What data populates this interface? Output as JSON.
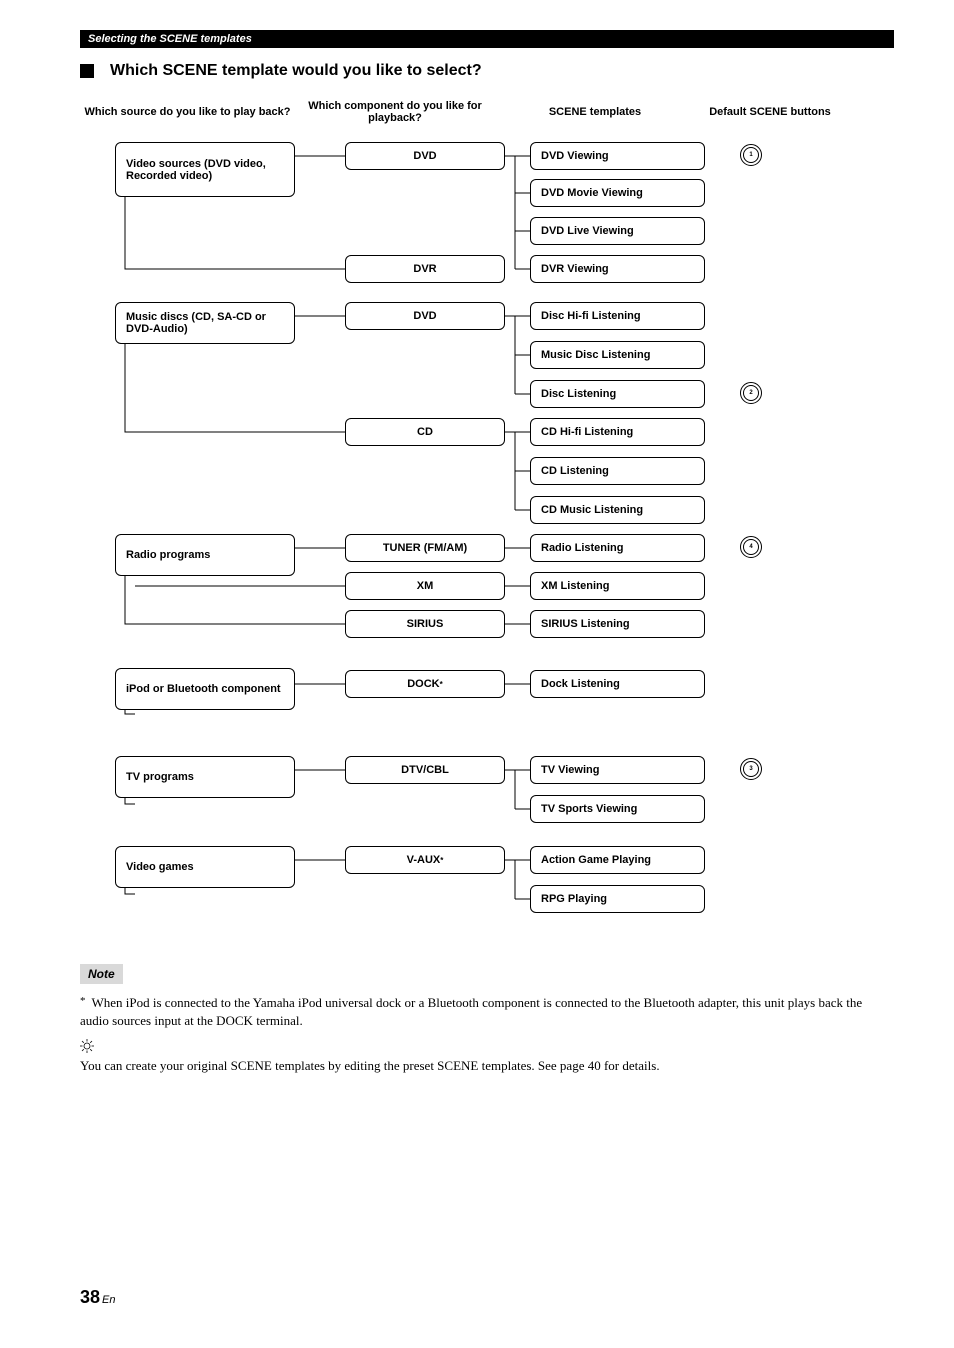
{
  "header_bar": "Selecting the SCENE templates",
  "section_title": "Which SCENE template would you like to select?",
  "columns": {
    "c1": "Which source do you like to play back?",
    "c2": "Which component do you like for playback?",
    "c3": "SCENE templates",
    "c4": "Default SCENE buttons"
  },
  "sources": {
    "video": "Video sources (DVD video, Recorded video)",
    "music": "Music discs (CD, SA-CD or DVD-Audio)",
    "radio": "Radio programs",
    "ipod": "iPod or Bluetooth component",
    "tv": "TV programs",
    "games": "Video games"
  },
  "components": {
    "dvd1": "DVD",
    "dvr": "DVR",
    "dvd2": "DVD",
    "cd": "CD",
    "tuner": "TUNER (FM/AM)",
    "xm": "XM",
    "sirius": "SIRIUS",
    "dock": "DOCK",
    "dtv": "DTV/CBL",
    "vaux": "V-AUX"
  },
  "templates": {
    "dvd_view": "DVD Viewing",
    "dvd_movie": "DVD Movie Viewing",
    "dvd_live": "DVD Live Viewing",
    "dvr_view": "DVR Viewing",
    "disc_hifi": "Disc Hi-fi Listening",
    "music_disc": "Music Disc Listening",
    "disc_listen": "Disc Listening",
    "cd_hifi": "CD Hi-fi Listening",
    "cd_listen": "CD Listening",
    "cd_music": "CD Music Listening",
    "radio_listen": "Radio Listening",
    "xm_listen": "XM Listening",
    "sirius_listen": "SIRIUS Listening",
    "dock_listen": "Dock Listening",
    "tv_view": "TV Viewing",
    "tv_sports": "TV Sports Viewing",
    "action_game": "Action Game Playing",
    "rpg": "RPG Playing"
  },
  "buttons": {
    "b1": "1",
    "b2": "2",
    "b3": "3",
    "b4": "4"
  },
  "note_label": "Note",
  "note_text": "When iPod is connected to the Yamaha iPod universal dock or a Bluetooth component is connected to the Bluetooth adapter, this unit plays back the audio sources input at the DOCK terminal.",
  "tip_text": "You can create your original SCENE templates by editing the preset SCENE templates. See page 40 for details.",
  "page_number": "38",
  "page_lang": "En",
  "asterisk": "*"
}
